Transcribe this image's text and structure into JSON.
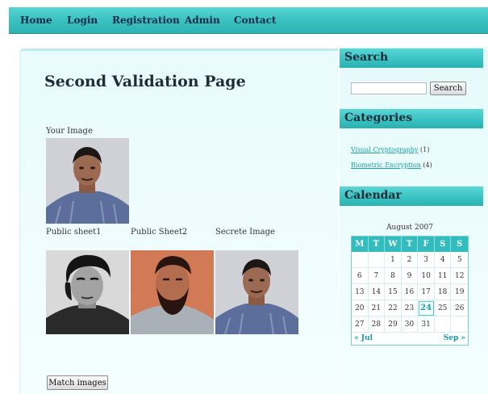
{
  "nav": {
    "items": [
      "Home",
      "Login",
      "Registration",
      "Admin",
      "Contact"
    ]
  },
  "main": {
    "title": "Second Validation Page",
    "your_image_label": "Your Image",
    "public_sheet1_label": "Public sheet1",
    "public_sheet2_label": "Public Sheet2",
    "secret_image_label": "Secrete Image",
    "match_button": "Match images"
  },
  "sidebar": {
    "search": {
      "heading": "Search",
      "input_value": "",
      "button": "Search"
    },
    "categories": {
      "heading": "Categories",
      "items": [
        {
          "label": "Visual Cryptography",
          "count": "(1)"
        },
        {
          "label": "Biometric Encryption",
          "count": "(4)"
        }
      ]
    },
    "calendar": {
      "heading": "Calendar",
      "month_label": "August 2007",
      "weekdays": [
        "M",
        "T",
        "W",
        "T",
        "F",
        "S",
        "S"
      ],
      "weeks": [
        [
          "",
          "",
          "1",
          "2",
          "3",
          "4",
          "5"
        ],
        [
          "6",
          "7",
          "8",
          "9",
          "10",
          "11",
          "12"
        ],
        [
          "13",
          "14",
          "15",
          "16",
          "17",
          "18",
          "19"
        ],
        [
          "20",
          "21",
          "22",
          "23",
          "24",
          "25",
          "26"
        ],
        [
          "27",
          "28",
          "29",
          "30",
          "31",
          "",
          ""
        ]
      ],
      "today": "24",
      "prev": "« Jul",
      "next": "Sep »"
    }
  },
  "colors": {
    "accent": "#3cc3c2",
    "link": "#1a9fa3",
    "nav_text": "#0d2a48"
  }
}
